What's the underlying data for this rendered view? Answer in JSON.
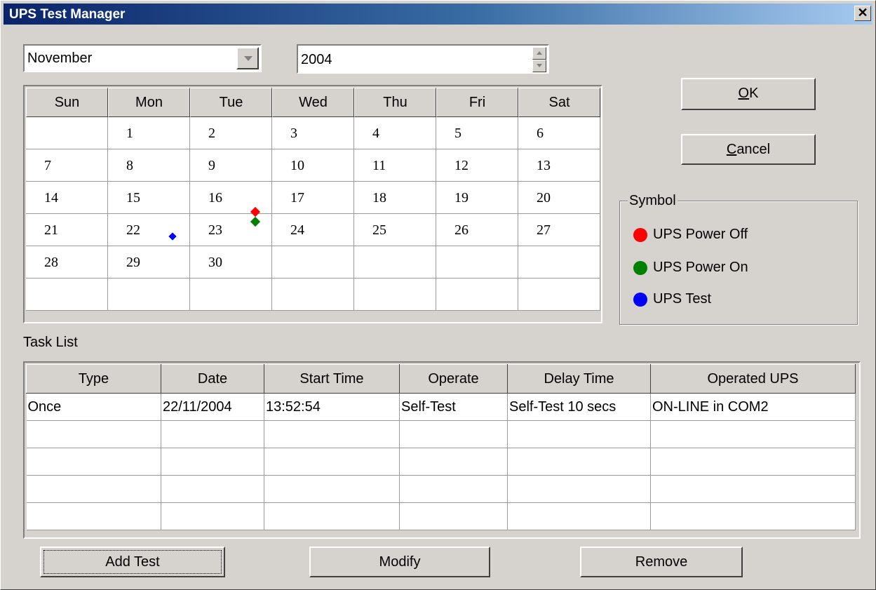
{
  "window": {
    "title": "UPS Test Manager",
    "close_glyph": "✕"
  },
  "month": {
    "value": "November"
  },
  "year": {
    "value": "2004"
  },
  "calendar": {
    "days_of_week": [
      "Sun",
      "Mon",
      "Tue",
      "Wed",
      "Thu",
      "Fri",
      "Sat"
    ],
    "weeks": [
      [
        "",
        "1",
        "2",
        "3",
        "4",
        "5",
        "6"
      ],
      [
        "7",
        "8",
        "9",
        "10",
        "11",
        "12",
        "13"
      ],
      [
        "14",
        "15",
        "16",
        "17",
        "18",
        "19",
        "20"
      ],
      [
        "21",
        "22",
        "23",
        "24",
        "25",
        "26",
        "27"
      ],
      [
        "28",
        "29",
        "30",
        "",
        "",
        "",
        ""
      ],
      [
        "",
        "",
        "",
        "",
        "",
        "",
        ""
      ]
    ],
    "markers": [
      {
        "day": "22",
        "types": [
          "test"
        ]
      },
      {
        "day": "23",
        "types": [
          "power_off",
          "power_on"
        ]
      }
    ]
  },
  "buttons": {
    "ok_label": "OK",
    "ok_accel": "O",
    "cancel_label": "Cancel",
    "cancel_accel": "C",
    "add_test_label": "Add Test",
    "modify_label": "Modify",
    "remove_label": "Remove"
  },
  "symbol": {
    "title": "Symbol",
    "items": [
      {
        "label": "UPS Power Off",
        "color": "#ff0000",
        "key": "power_off"
      },
      {
        "label": "UPS Power On",
        "color": "#008000",
        "key": "power_on"
      },
      {
        "label": "UPS Test",
        "color": "#0000ff",
        "key": "test"
      }
    ]
  },
  "task_list": {
    "label": "Task List",
    "columns": [
      "Type",
      "Date",
      "Start Time",
      "Operate",
      "Delay Time",
      "Operated UPS"
    ],
    "rows": [
      [
        "Once",
        "22/11/2004",
        "13:52:54",
        "Self-Test",
        "Self-Test 10 secs",
        "ON-LINE in COM2"
      ],
      [
        "",
        "",
        "",
        "",
        "",
        ""
      ],
      [
        "",
        "",
        "",
        "",
        "",
        ""
      ],
      [
        "",
        "",
        "",
        "",
        "",
        ""
      ],
      [
        "",
        "",
        "",
        "",
        "",
        ""
      ]
    ]
  }
}
